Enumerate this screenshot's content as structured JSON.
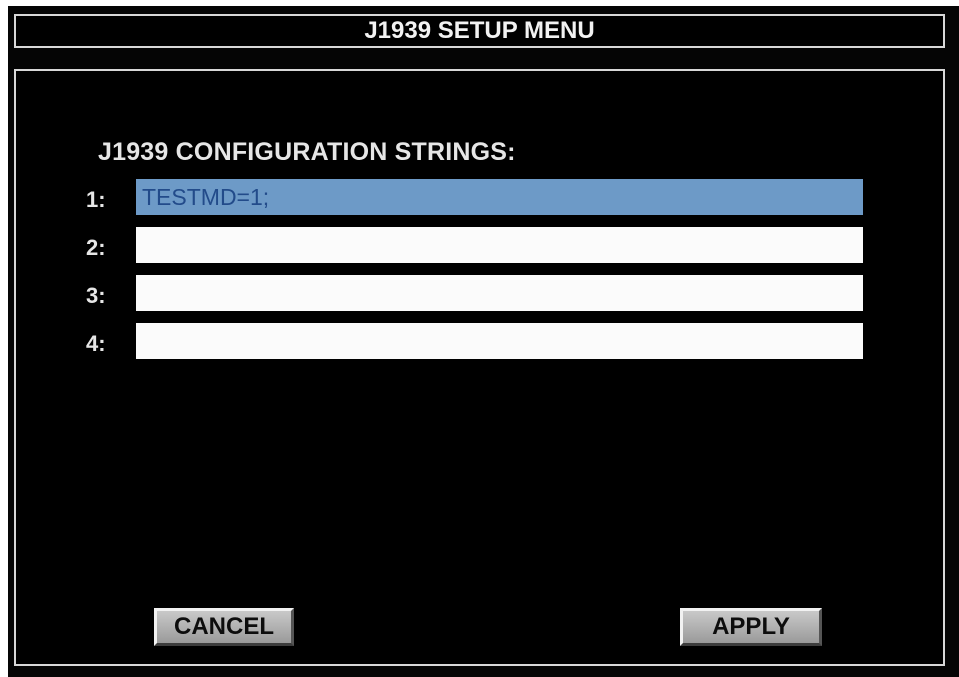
{
  "menu": {
    "title": "J1939 SETUP MENU",
    "section_label": "J1939 CONFIGURATION STRINGS:",
    "strings": [
      {
        "number": "1:",
        "value": "TESTMD=1;"
      },
      {
        "number": "2:",
        "value": ""
      },
      {
        "number": "3:",
        "value": ""
      },
      {
        "number": "4:",
        "value": ""
      }
    ],
    "cancel_label": "CANCEL",
    "apply_label": "APPLY"
  },
  "colors": {
    "background": "#050505",
    "frame_border": "#d8d8d8",
    "selected_field": "#6d9ac7",
    "field": "#fbfbfb",
    "button": "#b5b5b5"
  }
}
